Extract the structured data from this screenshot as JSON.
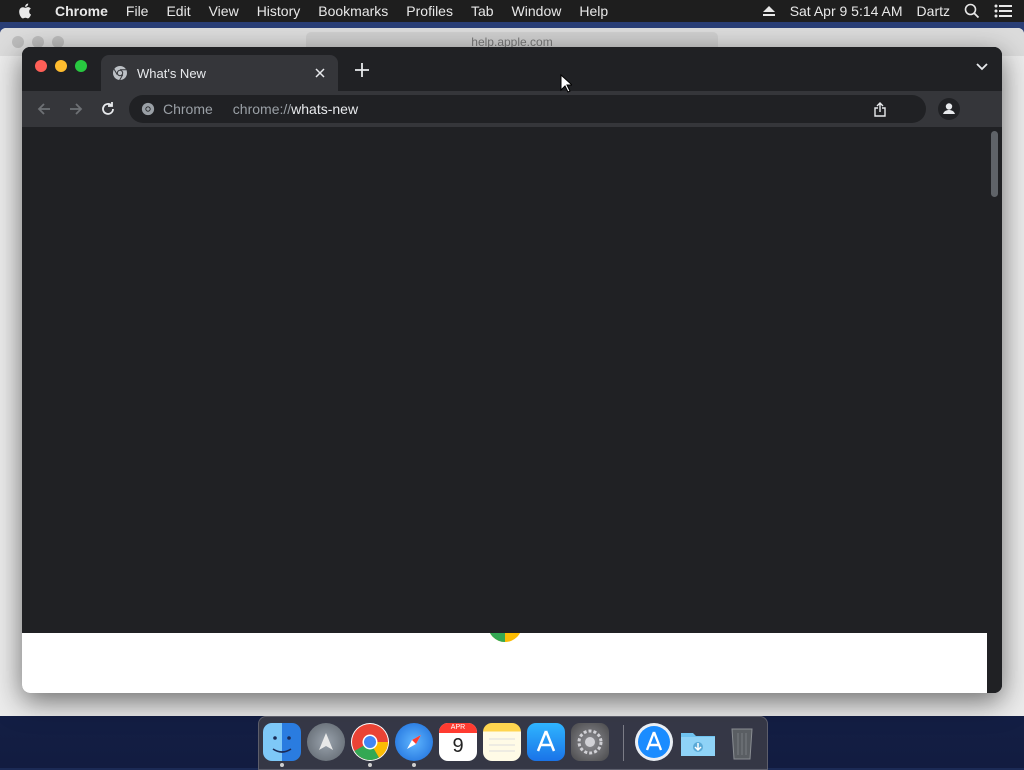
{
  "menubar": {
    "app_name": "Chrome",
    "menus": [
      "File",
      "Edit",
      "View",
      "History",
      "Bookmarks",
      "Profiles",
      "Tab",
      "Window",
      "Help"
    ],
    "clock": "Sat Apr 9  5:14 AM",
    "user": "Dartz"
  },
  "background_window": {
    "address": "help.apple.com"
  },
  "browser": {
    "tab": {
      "title": "What's New"
    },
    "omnibox": {
      "chip_label": "Chrome",
      "url_scheme": "chrome://",
      "url_path": "whats-new"
    }
  },
  "dock": {
    "items": [
      {
        "name": "Finder",
        "icon": "finder-icon"
      },
      {
        "name": "Launchpad",
        "icon": "launchpad-icon"
      },
      {
        "name": "Google Chrome",
        "icon": "chrome-icon"
      },
      {
        "name": "Safari",
        "icon": "safari-icon"
      },
      {
        "name": "Calendar",
        "icon": "calendar-icon"
      },
      {
        "name": "Notes",
        "icon": "notes-icon"
      },
      {
        "name": "App Store",
        "icon": "app-store-icon"
      },
      {
        "name": "System Preferences",
        "icon": "system-preferences-icon"
      },
      {
        "name": "App Store",
        "icon": "app-store-icon"
      },
      {
        "name": "Downloads",
        "icon": "downloads-folder-icon"
      },
      {
        "name": "Trash",
        "icon": "trash-icon"
      }
    ],
    "calendar": {
      "month": "APR",
      "day": "9"
    }
  },
  "colors": {
    "page_bg": "#202124",
    "toolbar_bg": "#35363a",
    "text_primary": "#e8eaed",
    "text_secondary": "#9aa0a6"
  }
}
